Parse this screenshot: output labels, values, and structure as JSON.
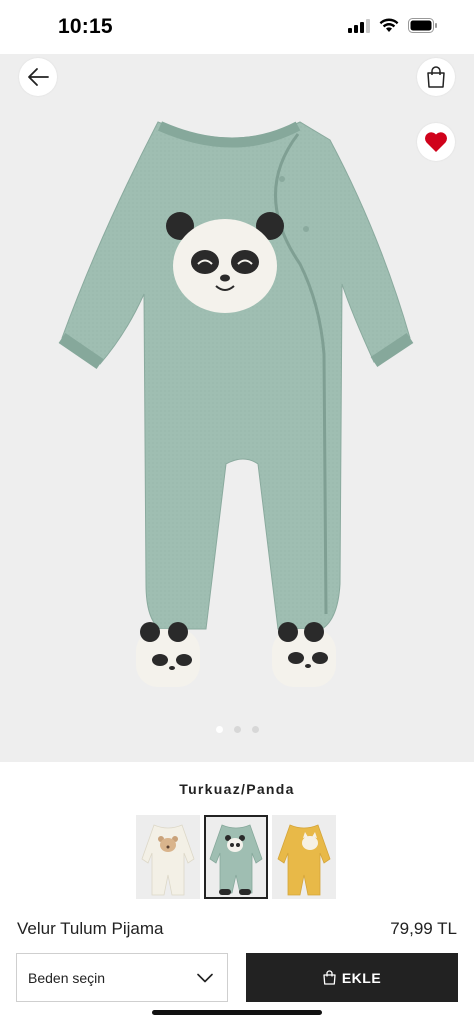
{
  "status_bar": {
    "time": "10:15",
    "icons": [
      "signal-icon",
      "wifi-icon",
      "battery-icon"
    ]
  },
  "header": {
    "back_icon": "arrow-left-icon",
    "bag_icon": "shopping-bag-icon",
    "favorite_icon": "heart-icon",
    "favorite_active": true,
    "favorite_color": "#d0021b"
  },
  "gallery": {
    "image_count": 3,
    "active_index": 0
  },
  "product": {
    "color_name": "Turkuaz/Panda",
    "name": "Velur Tulum Pijama",
    "price": "79,99 TL"
  },
  "swatches": [
    {
      "color": "#f3f0e6",
      "motif": "bear",
      "selected": false
    },
    {
      "color": "#9fbeb2",
      "motif": "panda",
      "selected": true
    },
    {
      "color": "#e8b948",
      "motif": "cat",
      "selected": false
    }
  ],
  "actions": {
    "size_placeholder": "Beden seçin",
    "add_label": "EKLE"
  },
  "colors": {
    "garment": "#9fbeb2",
    "button": "#222222"
  }
}
